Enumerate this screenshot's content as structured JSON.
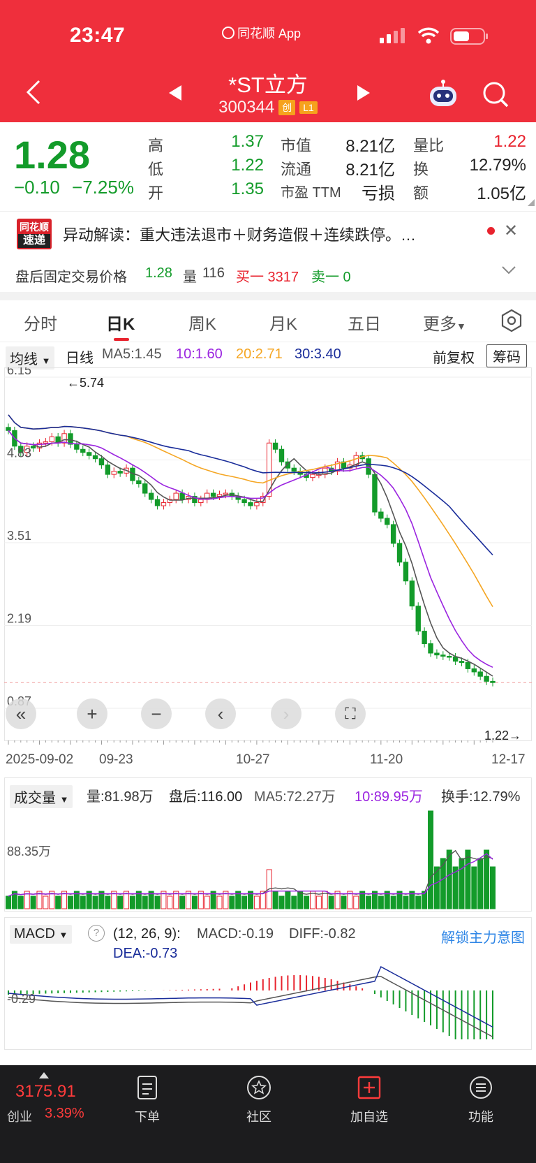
{
  "status": {
    "time": "23:47",
    "app": "同花顺 App"
  },
  "stock": {
    "name": "*ST立方",
    "code": "300344",
    "tag1": "创",
    "tag2": "L1"
  },
  "quote": {
    "price": "1.28",
    "change": "−0.10",
    "change_pct": "−7.25%",
    "high_label": "高",
    "high": "1.37",
    "low_label": "低",
    "low": "1.22",
    "open_label": "开",
    "open": "1.35",
    "mcap_label": "市值",
    "mcap": "8.21亿",
    "float_label": "流通",
    "float": "8.21亿",
    "pe_label": "市盈 TTM",
    "pe": "亏损",
    "volratio_label": "量比",
    "volratio": "1.22",
    "turnover_label": "换",
    "turnover": "12.79%",
    "amount_label": "额",
    "amount": "1.05亿"
  },
  "news": {
    "logo_top": "同花顺",
    "logo_bottom": "速递",
    "text": "异动解读：重大违法退市＋财务造假＋连续跌停。…"
  },
  "postclose": {
    "label": "盘后固定交易价格",
    "price": "1.28",
    "vol_label": "量",
    "vol": "116",
    "buy1": "买一 3317",
    "sell1": "卖一 0"
  },
  "tabs": [
    "分时",
    "日K",
    "周K",
    "月K",
    "五日",
    "更多"
  ],
  "ma_row": {
    "selector": "均线",
    "period": "日线",
    "ma5": "MA5:1.45",
    "ma10": "10:1.60",
    "ma20": "20:2.71",
    "ma30": "30:3.40",
    "adjust": "前复权",
    "chip": "筹码"
  },
  "kchart": {
    "y_ticks": [
      "6.15",
      "4.83",
      "3.51",
      "2.19",
      "0.87"
    ],
    "max_label": "←5.74",
    "min_label": "1.22→",
    "dates": [
      "2025-09-02",
      "09-23",
      "10-27",
      "11-20",
      "12-17"
    ]
  },
  "vol_row": {
    "selector": "成交量",
    "vol": "量:81.98万",
    "post": "盘后:116.00",
    "ma5": "MA5:72.27万",
    "ma10": "10:89.95万",
    "turnover": "换手:12.79%",
    "y_label": "88.35万"
  },
  "macd_row": {
    "selector": "MACD",
    "params": "(12, 26, 9):",
    "macd": "MACD:-0.19",
    "diff": "DIFF:-0.82",
    "dea": "DEA:-0.73",
    "unlock": "解锁主力意图",
    "y_label": "-0.29"
  },
  "bottom": {
    "index_val": "3175.91",
    "index_name": "创业",
    "index_pct": "3.39%",
    "nav": [
      "下单",
      "社区",
      "加自选",
      "功能"
    ]
  },
  "colors": {
    "up": "#e8232e",
    "down": "#139b2a",
    "header": "#ef2f3c",
    "ma5": "#555555",
    "ma10": "#9b25e0",
    "ma20": "#f5a623",
    "ma30": "#1a2d9a"
  }
}
